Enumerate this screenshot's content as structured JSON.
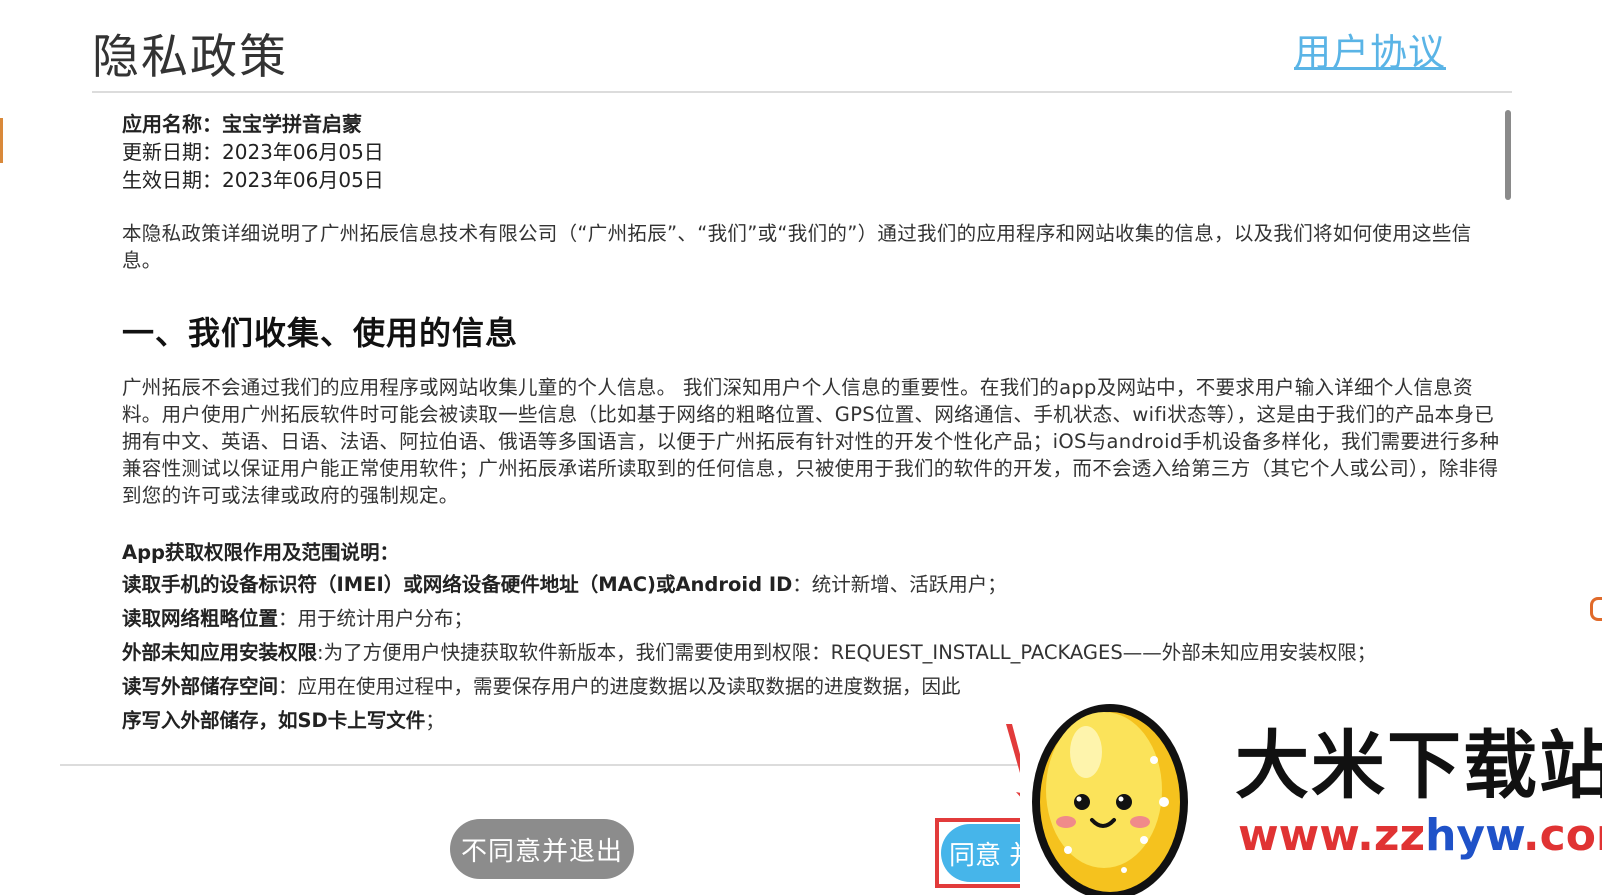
{
  "header": {
    "title": "隐私政策",
    "user_agreement_link": "用户协议"
  },
  "meta": {
    "app_name_label": "应用名称：",
    "app_name": "宝宝学拼音启蒙",
    "updated_label": "更新日期：",
    "updated_date": "2023年06月05日",
    "effective_label": "生效日期：",
    "effective_date": "2023年06月05日"
  },
  "intro": "本隐私政策详细说明了广州拓辰信息技术有限公司（“广州拓辰”、“我们”或“我们的”）通过我们的应用程序和网站收集的信息，以及我们将如何使用这些信息。",
  "section1": {
    "heading": "一、我们收集、使用的信息",
    "body": "广州拓辰不会通过我们的应用程序或网站收集儿童的个人信息。 我们深知用户个人信息的重要性。在我们的app及网站中，不要求用户输入详细个人信息资料。用户使用广州拓辰软件时可能会被读取一些信息（比如基于网络的粗略位置、GPS位置、网络通信、手机状态、wifi状态等），这是由于我们的产品本身已拥有中文、英语、日语、法语、阿拉伯语、俄语等多国语言，以便于广州拓辰有针对性的开发个性化产品；iOS与android手机设备多样化，我们需要进行多种兼容性测试以保证用户能正常使用软件；广州拓辰承诺所读取到的任何信息，只被使用于我们的软件的开发，而不会透入给第三方（其它个人或公司），除非得到您的许可或法律或政府的强制规定。"
  },
  "permissions": {
    "title": "App获取权限作用及范围说明：",
    "items": [
      {
        "key": "读取手机的设备标识符（IMEI）或网络设备硬件地址（MAC)或Android ID",
        "value": "：统计新增、活跃用户；"
      },
      {
        "key": "读取网络粗略位置",
        "value": "：用于统计用户分布；"
      },
      {
        "key": "外部未知应用安装权限",
        "value": ":为了方便用户快捷获取软件新版本，我们需要使用到权限：REQUEST_INSTALL_PACKAGES——外部未知应用安装权限；"
      },
      {
        "key": "读写外部储存空间",
        "value": "：应用在使用过程中，需要保存用户的进度数据以及读取数据的进度数据，因此"
      },
      {
        "key": "序写入外部储存，如SD卡上写文件",
        "value": "；"
      }
    ]
  },
  "footer": {
    "decline_label": "不同意并退出",
    "agree_label": "同意 并"
  },
  "watermark": {
    "name": "大米下载站",
    "url_prefix": "www.zz",
    "url_mid": "hyw",
    "url_suffix": ".com"
  },
  "colors": {
    "link": "#5ab4e6",
    "agree_button": "#46b5ea",
    "decline_button": "#8c8c8c",
    "highlight_frame": "#e23b3b"
  }
}
